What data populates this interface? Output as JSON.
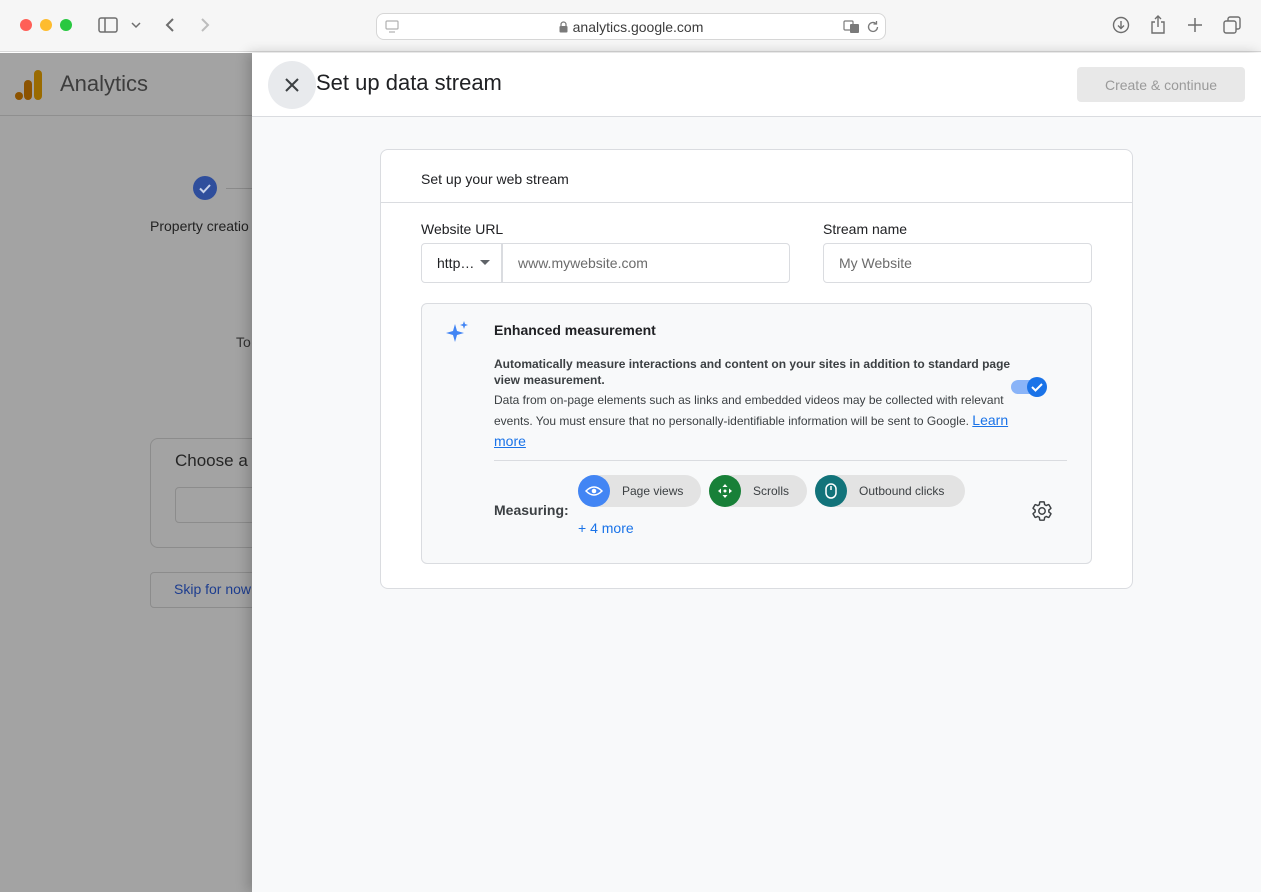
{
  "browser": {
    "url": "analytics.google.com",
    "colors": {
      "close": "#ff5f57",
      "minimize": "#febc2e",
      "zoom": "#28c840"
    }
  },
  "background": {
    "app_name": "Analytics",
    "step_label": "Property creatio",
    "body_text": "To",
    "card_title": "Choose a p",
    "skip_label": "Skip for now"
  },
  "panel": {
    "title": "Set up data stream",
    "create_label": "Create & continue",
    "card_title": "Set up your web stream",
    "url_label": "Website URL",
    "protocol_value": "http…",
    "url_placeholder": "www.mywebsite.com",
    "name_label": "Stream name",
    "name_placeholder": "My Website",
    "enhanced": {
      "title": "Enhanced measurement",
      "bold_text": "Automatically measure interactions and content on your sites in addition to standard page view measurement.",
      "description": "Data from on-page elements such as links and embedded videos may be collected with relevant events. You must ensure that no personally-identifiable information will be sent to Google.",
      "learn_more": "Learn more",
      "toggle_on": true,
      "measuring_label": "Measuring:",
      "chips": [
        {
          "label": "Page views",
          "icon": "eye-icon",
          "color": "#4285f4"
        },
        {
          "label": "Scrolls",
          "icon": "move-arrows-icon",
          "color": "#188038"
        },
        {
          "label": "Outbound clicks",
          "icon": "mouse-icon",
          "color": "#12737a"
        }
      ],
      "more_label": "+ 4 more"
    }
  }
}
